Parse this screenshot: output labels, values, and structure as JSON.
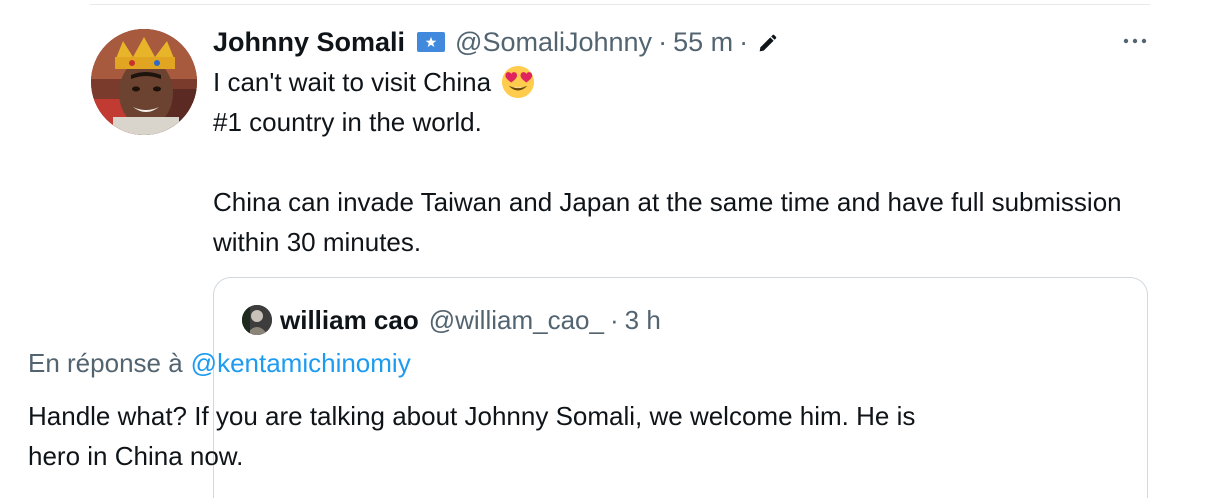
{
  "tweet": {
    "author": {
      "display_name": "Johnny Somali",
      "flag_icon": "somalia-flag-icon",
      "handle": "@SomaliJohnny",
      "time": "55 m",
      "separator": "·",
      "edited_icon": "pencil-edit-icon"
    },
    "more_icon": "more-dots-icon",
    "text": {
      "line1": "I can't wait to visit China",
      "line1_emoji": "heart-eyes-emoji",
      "line2": "#1 country in the world.",
      "paragraph2": "China can invade Taiwan and Japan at the same time and have full submission within 30 minutes."
    }
  },
  "quote": {
    "author": {
      "display_name": "william cao",
      "handle": "@william_cao_",
      "separator": "·",
      "time": "3 h"
    },
    "reply_prefix": "En réponse à",
    "reply_mention": "@kentamichinomiy",
    "text": "Handle what? If you are talking about Johnny Somali, we welcome him. He is hero in China now."
  },
  "colors": {
    "text_primary": "#0f1419",
    "text_secondary": "#536471",
    "link": "#1d9bf0",
    "border": "#cfd9de",
    "somalia_flag_blue": "#4189dd"
  }
}
